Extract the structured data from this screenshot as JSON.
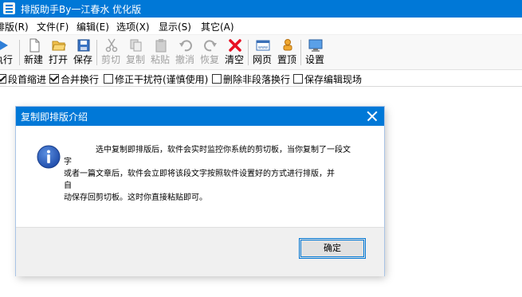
{
  "window": {
    "title": "排版助手By一江春水 优化版"
  },
  "menu": [
    "排版(R)",
    "文件(F)",
    "编辑(E)",
    "选项(X)",
    "显示(S)",
    "其它(A)"
  ],
  "toolbar": {
    "run": {
      "label": "执行",
      "icon": "run-arrow-icon"
    },
    "new": {
      "label": "新建",
      "icon": "new-document-icon"
    },
    "open": {
      "label": "打开",
      "icon": "open-folder-icon"
    },
    "save": {
      "label": "保存",
      "icon": "save-disk-icon"
    },
    "cut": {
      "label": "剪切",
      "icon": "scissors-icon"
    },
    "copy": {
      "label": "复制",
      "icon": "copy-icon"
    },
    "paste": {
      "label": "粘贴",
      "icon": "paste-icon"
    },
    "undo": {
      "label": "撤消",
      "icon": "undo-icon"
    },
    "redo": {
      "label": "恢复",
      "icon": "redo-icon"
    },
    "clear": {
      "label": "清空",
      "icon": "clear-x-icon"
    },
    "web": {
      "label": "网页",
      "icon": "web-page-icon"
    },
    "top": {
      "label": "置顶",
      "icon": "pin-top-icon"
    },
    "settings": {
      "label": "设置",
      "icon": "settings-monitor-icon"
    }
  },
  "options": [
    {
      "label": "段首缩进",
      "checked": true
    },
    {
      "label": "合并换行",
      "checked": true
    },
    {
      "label": "修正干扰符(谨慎使用)",
      "checked": false
    },
    {
      "label": "删除非段落换行",
      "checked": false
    },
    {
      "label": "保存编辑现场",
      "checked": false
    }
  ],
  "dialog": {
    "title": "复制即排版介绍",
    "icon": "info-icon",
    "message_lines": [
      "选中复制即排版后，软件会实时监控你系统的剪切板，当你复制了一段文",
      "字",
      "或者一篇文章后，软件会立即将该段文字按照软件设置好的方式进行排版，并",
      "自",
      "动保存回剪切板。这时你直接粘贴即可。"
    ],
    "ok_label": "确定"
  },
  "colors": {
    "accent": "#0078d7",
    "clear_red": "#e81123"
  }
}
